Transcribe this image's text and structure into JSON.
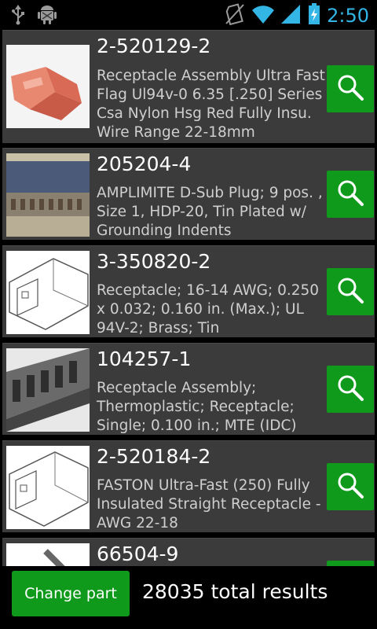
{
  "status_bar": {
    "time": "2:50",
    "icons": [
      "usb-icon",
      "android-debug-icon",
      "no-sim-icon",
      "wifi-icon",
      "signal-icon",
      "battery-charging-icon"
    ]
  },
  "results": [
    {
      "part_number": "2-520129-2",
      "description": "Receptacle Assembly Ultra Fast Flag Ul94v-0 6.35 [.250] Series Csa Nylon Hsg Red Fully Insu. Wire Range 22-18mm",
      "thumbnail": "red-flag-receptacle"
    },
    {
      "part_number": "205204-4",
      "description": "AMPLIMITE D-Sub Plug; 9 pos. , Size 1, HDP-20, Tin Plated w/ Grounding Indents",
      "thumbnail": "d-sub-plug"
    },
    {
      "part_number": "3-350820-2",
      "description": "Receptacle; 16-14 AWG; 0.250 x 0.032; 0.160 in. (Max.); UL 94V-2; Brass; Tin",
      "thumbnail": "receptacle-drawing"
    },
    {
      "part_number": "104257-1",
      "description": "Receptacle Assembly; Thermoplastic; Receptacle; Single; 0.100 in.; MTE (IDC)",
      "thumbnail": "idc-receptacle-strip"
    },
    {
      "part_number": "2-520184-2",
      "description": "FASTON Ultra-Fast (250) Fully Insulated Straight Receptacle - AWG 22-18",
      "thumbnail": "faston-drawing"
    },
    {
      "part_number": "66504-9",
      "description": "",
      "thumbnail": "contact-pin"
    }
  ],
  "bottom": {
    "change_part_label": "Change part",
    "total_results": "28035 total results"
  }
}
